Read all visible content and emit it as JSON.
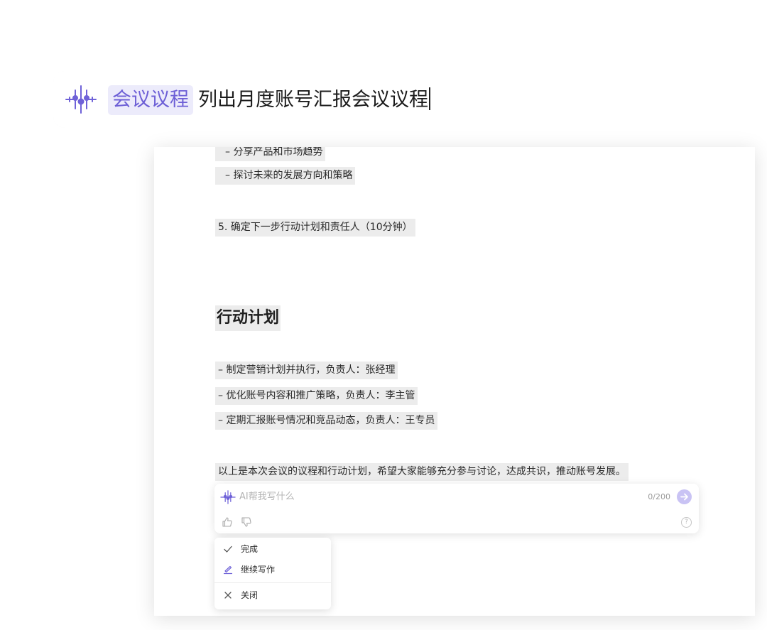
{
  "prompt": {
    "logo_icon": "ai-sparkle-icon",
    "tag": "会议议程",
    "input_text": "列出月度账号汇报会议议程",
    "accent": "#6d5fd6",
    "tag_bg": "#ecebfb"
  },
  "document": {
    "partial_line": "– 分享产品和市场趋势",
    "lines_top": [
      "– 探讨未来的发展方向和策略"
    ],
    "agenda_item": "5. 确定下一步行动计划和责任人（10分钟）",
    "heading": "行动计划",
    "action_items": [
      "– 制定营销计划并执行，负责人：张经理",
      "– 优化账号内容和推广策略，负责人：李主管",
      "– 定期汇报账号情况和竞品动态，负责人：王专员"
    ],
    "closing": "以上是本次会议的议程和行动计划，希望大家能够充分参与讨论，达成共识，推动账号发展。"
  },
  "ai_box": {
    "placeholder": "AI帮我写什么",
    "counter": "0/200",
    "send_icon": "arrow-right-icon",
    "like_icon": "thumbs-up-icon",
    "dislike_icon": "thumbs-down-icon",
    "help_label": "?"
  },
  "menu": {
    "items": [
      {
        "label": "完成",
        "icon": "check-icon"
      },
      {
        "label": "继续写作",
        "icon": "pen-icon"
      },
      {
        "label": "关闭",
        "icon": "close-icon"
      }
    ]
  }
}
